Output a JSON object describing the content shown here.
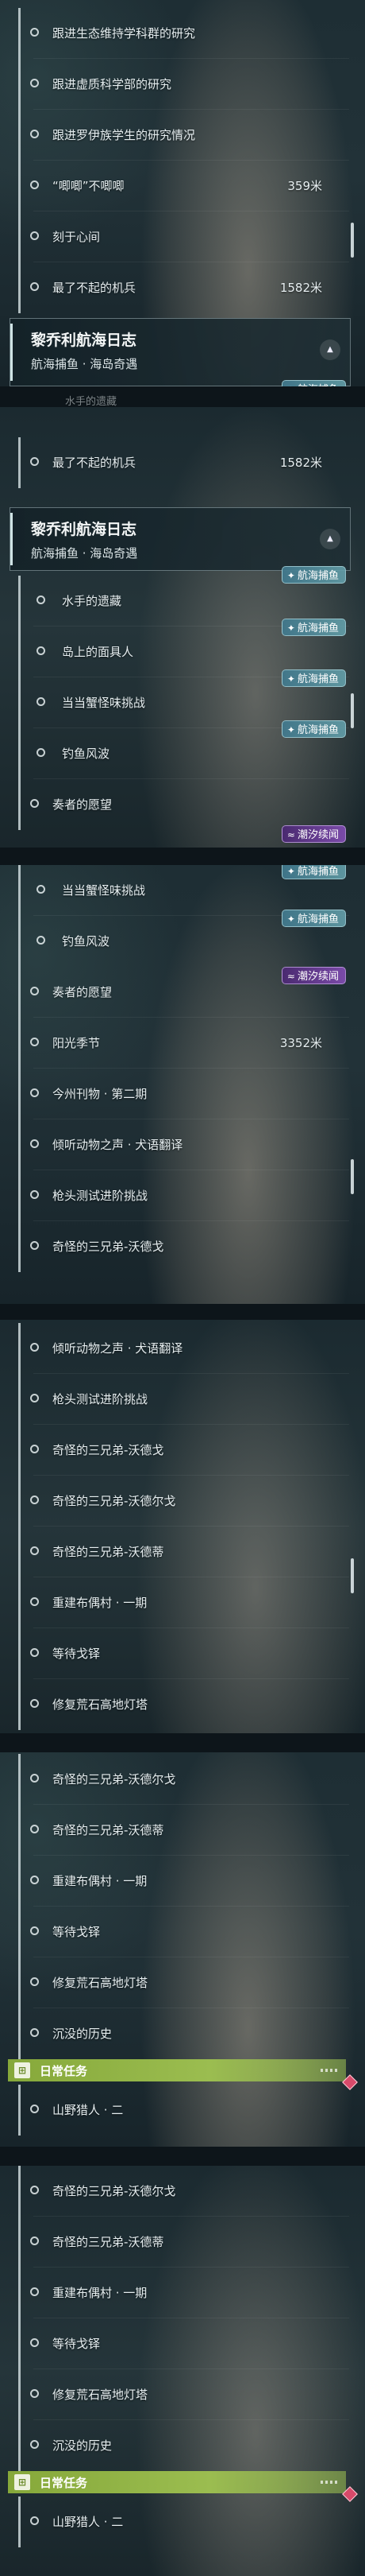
{
  "header": {
    "title": "黎乔利航海日志",
    "subtitle": "航海捕鱼 · 海岛奇遇"
  },
  "tags": {
    "fishing": "航海捕鱼",
    "tide": "潮汐续闻"
  },
  "daily": {
    "label": "日常任务"
  },
  "quests": {
    "ecology": "跟进生态维持学科群的研究",
    "illusion": "跟进虚质科学部的研究",
    "rooiba": "跟进罗伊族学生的研究情况",
    "jiji": "“唧唧”不唧唧",
    "hearts": "刻于心间",
    "machine": "最了不起的机兵",
    "heritage": "水手的遗藏",
    "mask": "岛上的面具人",
    "crab": "当当蟹怪味挑战",
    "fish_wave": "钓鱼风波",
    "player_wish": "奏者的愿望",
    "sun_festival": "阳光季节",
    "journal": "今州刊物 · 第二期",
    "animal": "倾听动物之声 · 犬语翻译",
    "gun": "枪头测试进阶挑战",
    "trio_woodge": "奇怪的三兄弟-沃德戈",
    "trio_woodel": "奇怪的三兄弟-沃德尔戈",
    "trio_woodeb": "奇怪的三兄弟-沃德蒂",
    "rebuild": "重建布偶村 · 一期",
    "wait": "等待戈铎",
    "lighthouse": "修复荒石高地灯塔",
    "history": "沉没的历史",
    "hunter": "山野猎人 · 二",
    "cutoff_heritage": "水手的遗藏",
    "cutoff_lighthouse": "修复荒石高地灯塔"
  },
  "distances": {
    "jiji": "359米",
    "machine": "1582米",
    "sun": "3352米"
  },
  "icons": {
    "collapse": "chevron-up-icon",
    "quest": "circle-marker-icon",
    "daily": "book-icon",
    "fish": "fish-icon",
    "tide": "wave-icon",
    "diamond": "waypoint-diamond-icon"
  },
  "colors": {
    "daily_bar": "#8fb044",
    "tide_tag": "#6a3e98",
    "fish_tag": "#4f8ea0",
    "waypoint": "#d84a6a"
  }
}
